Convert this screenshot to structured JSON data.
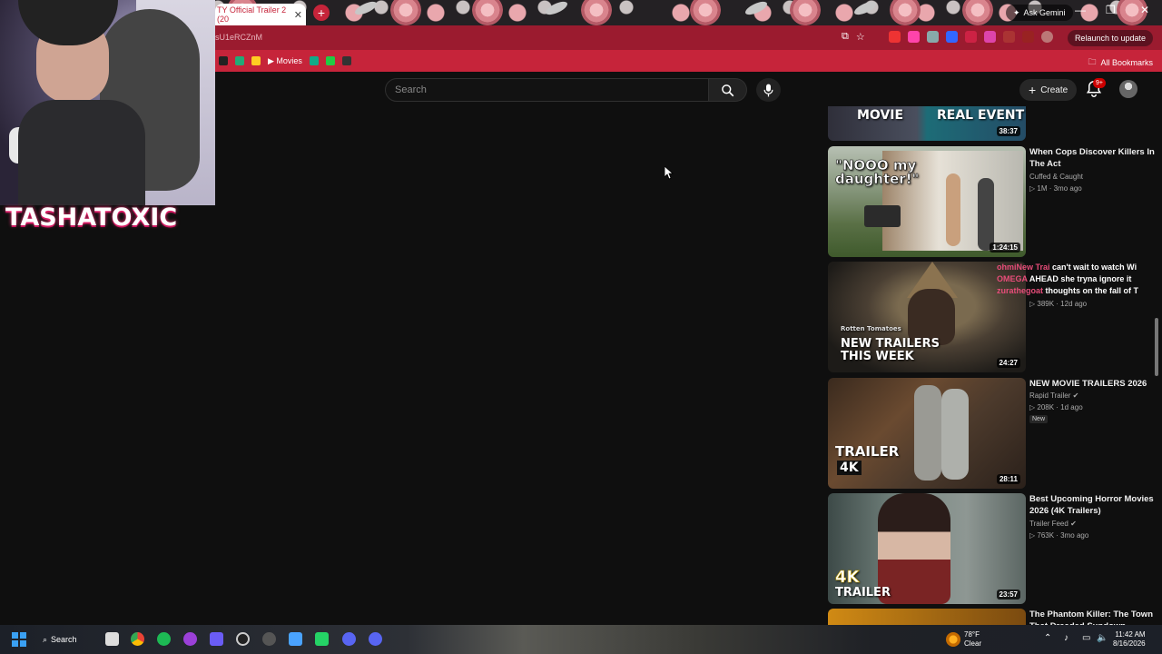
{
  "browser": {
    "tab_title": "TY Official Trailer 2 (20",
    "new_tab_label": "+",
    "ask_gemini": "Ask Gemini",
    "url": "sU1eRCZnM",
    "relaunch": "Relaunch to update",
    "bookmarks": [
      {
        "label": "Movies"
      }
    ],
    "all_bookmarks": "All Bookmarks"
  },
  "youtube": {
    "search_placeholder": "Search",
    "create_label": "Create",
    "notification_count": "9+",
    "videos": [
      {
        "thumb_text_left": "MOVIE",
        "thumb_text_right": "REAL EVENT",
        "duration": "38:37"
      },
      {
        "title": "When Cops Discover Killers In The Act",
        "channel": "Cuffed & Caught",
        "meta": "1M · 3mo ago",
        "thumb_text": "\"NOOO my daughter!\"",
        "duration": "1:24:15"
      },
      {
        "title": "",
        "channel": "",
        "meta": "389K · 12d ago",
        "thumb_brand": "Rotten Tomatoes",
        "thumb_text": "NEW TRAILERS THIS WEEK",
        "duration": "24:27"
      },
      {
        "title": "NEW MOVIE TRAILERS 2026",
        "channel": "Rapid Trailer",
        "meta": "208K · 1d ago",
        "badge": "New",
        "thumb_text": "TRAILER",
        "thumb_sub": "4K",
        "duration": "28:11"
      },
      {
        "title": "Best Upcoming Horror Movies 2026 (4K Trailers)",
        "channel": "Trailer Feed",
        "meta": "763K · 3mo ago",
        "thumb_text": "4K",
        "thumb_sub": "TRAILER",
        "duration": "23:57"
      },
      {
        "title": "The Phantom Killer: The Town That Dreaded Sundown"
      }
    ]
  },
  "overlay": {
    "streamer_name": "TASHATOXIC",
    "chat_lines": [
      {
        "user": "ohmiNew Trai",
        "text": "can't wait to watch Wi"
      },
      {
        "user": "OMEGA",
        "text": "AHEAD she tryna ignore it"
      },
      {
        "user": "zurathegoat",
        "text": "thoughts on the fall of T"
      }
    ]
  },
  "taskbar": {
    "search_label": "Search",
    "weather_temp": "78°F",
    "weather_desc": "Clear",
    "time": "11:42 AM",
    "date": "8/16/2026"
  }
}
